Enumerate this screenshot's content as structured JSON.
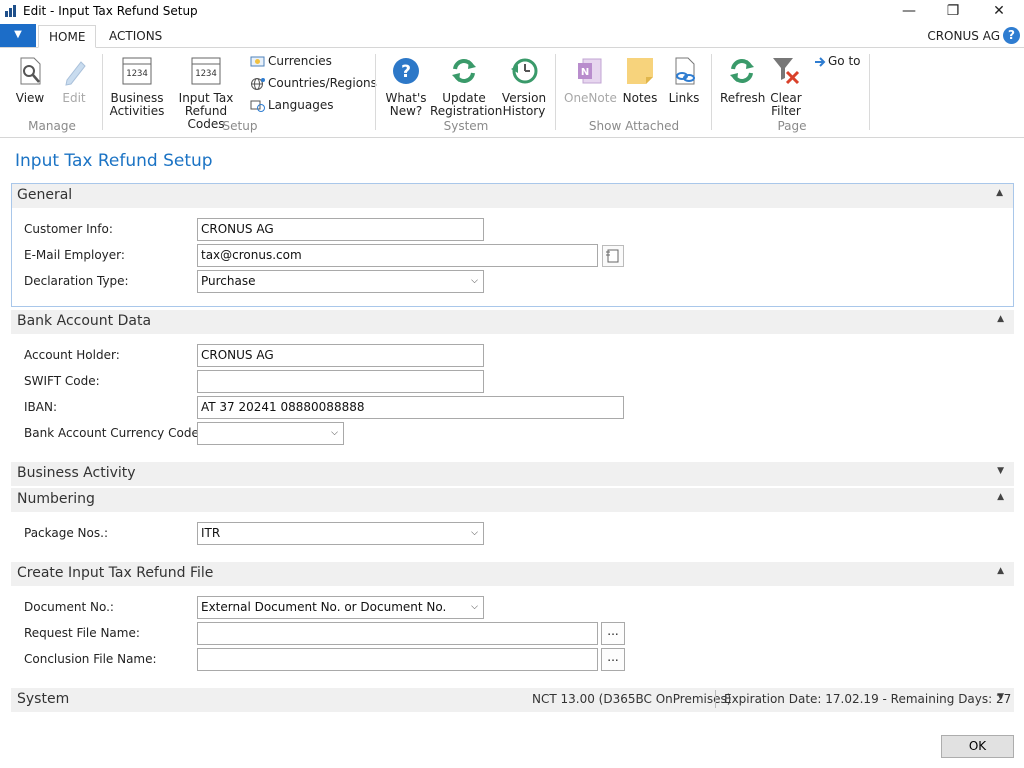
{
  "window": {
    "title": "Edit - Input Tax Refund Setup",
    "minimize": "—",
    "restore": "❐",
    "close": "✕"
  },
  "ribbon": {
    "app_menu": "▼",
    "tabs": [
      "HOME",
      "ACTIONS"
    ],
    "company": "CRONUS AG",
    "help": "?",
    "groups": {
      "manage": {
        "label": "Manage",
        "view": "View",
        "edit": "Edit"
      },
      "setup": {
        "label": "Setup",
        "business_activities": [
          "Business",
          "Activities"
        ],
        "input_tax_refund_codes": [
          "Input Tax",
          "Refund Codes"
        ],
        "currencies": "Currencies",
        "countries_regions": "Countries/Regions",
        "languages": "Languages"
      },
      "system": {
        "label": "System",
        "whats_new": [
          "What's",
          "New?"
        ],
        "update_registration": [
          "Update",
          "Registration"
        ],
        "version_history": [
          "Version",
          "History"
        ]
      },
      "show_attached": {
        "label": "Show Attached",
        "onenote": "OneNote",
        "notes": "Notes",
        "links": "Links"
      },
      "page": {
        "label": "Page",
        "refresh": "Refresh",
        "clear_filter": [
          "Clear",
          "Filter"
        ],
        "go_to": "Go to"
      }
    }
  },
  "page_title": "Input Tax Refund Setup",
  "sections": {
    "general": {
      "title": "General",
      "customer_info_label": "Customer Info:",
      "customer_info_value": "CRONUS AG",
      "email_label": "E-Mail Employer:",
      "email_value": "tax@cronus.com",
      "declaration_type_label": "Declaration Type:",
      "declaration_type_value": "Purchase"
    },
    "bank": {
      "title": "Bank Account Data",
      "account_holder_label": "Account Holder:",
      "account_holder_value": "CRONUS AG",
      "swift_label": "SWIFT Code:",
      "swift_value": "",
      "iban_label": "IBAN:",
      "iban_value": "AT 37 20241 08880088888",
      "currency_label": "Bank Account Currency Code:",
      "currency_value": ""
    },
    "business_activity": {
      "title": "Business Activity"
    },
    "numbering": {
      "title": "Numbering",
      "package_nos_label": "Package Nos.:",
      "package_nos_value": "ITR"
    },
    "create_file": {
      "title": "Create Input Tax Refund File",
      "document_no_label": "Document No.:",
      "document_no_value": "External Document No. or Document No.",
      "request_file_label": "Request File Name:",
      "request_file_value": "",
      "conclusion_file_label": "Conclusion File Name:",
      "conclusion_file_value": "",
      "ellipsis": "..."
    },
    "system": {
      "title": "System",
      "version": "NCT 13.00 (D365BC OnPremises)",
      "expiration": "Expiration Date: 17.02.19 - Remaining Days: 27"
    }
  },
  "chevrons": {
    "up": "▲",
    "down": "▼"
  },
  "ok_label": "OK"
}
